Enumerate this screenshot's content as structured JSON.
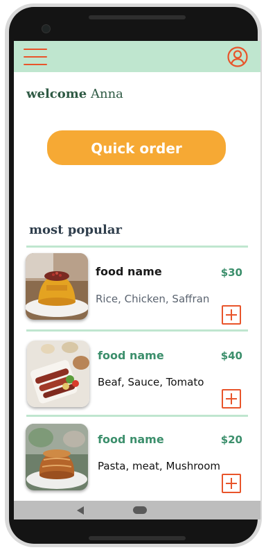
{
  "header": {
    "menu_icon": "hamburger-menu-icon",
    "profile_icon": "user-circle-icon"
  },
  "welcome": {
    "greeting": "welcome",
    "name": "Anna"
  },
  "quick_order": {
    "label": "Quick order"
  },
  "popular": {
    "title": "most popular",
    "items": [
      {
        "name": "food name",
        "price": "$30",
        "ingredients": "Rice, Chicken, Saffran",
        "image": "saffron-rice-chicken-photo",
        "name_color": "#1a1a1a",
        "ingredients_color": "#5b6470"
      },
      {
        "name": "food name",
        "price": "$40",
        "ingredients": "Beaf, Sauce, Tomato",
        "image": "kebab-platter-photo",
        "name_color": "#3c8f6c",
        "ingredients_color": "#111111"
      },
      {
        "name": "food name",
        "price": "$20",
        "ingredients": "Pasta, meat, Mushroom",
        "image": "pasta-cake-photo",
        "name_color": "#3c8f6c",
        "ingredients_color": "#111111"
      }
    ]
  },
  "colors": {
    "accent": "#e8542a",
    "appbar": "#bfe6cf",
    "button": "#f6a934",
    "price": "#3c8f6c"
  },
  "system_nav": {
    "back_icon": "back-triangle-icon",
    "home_icon": "home-pill-icon"
  }
}
